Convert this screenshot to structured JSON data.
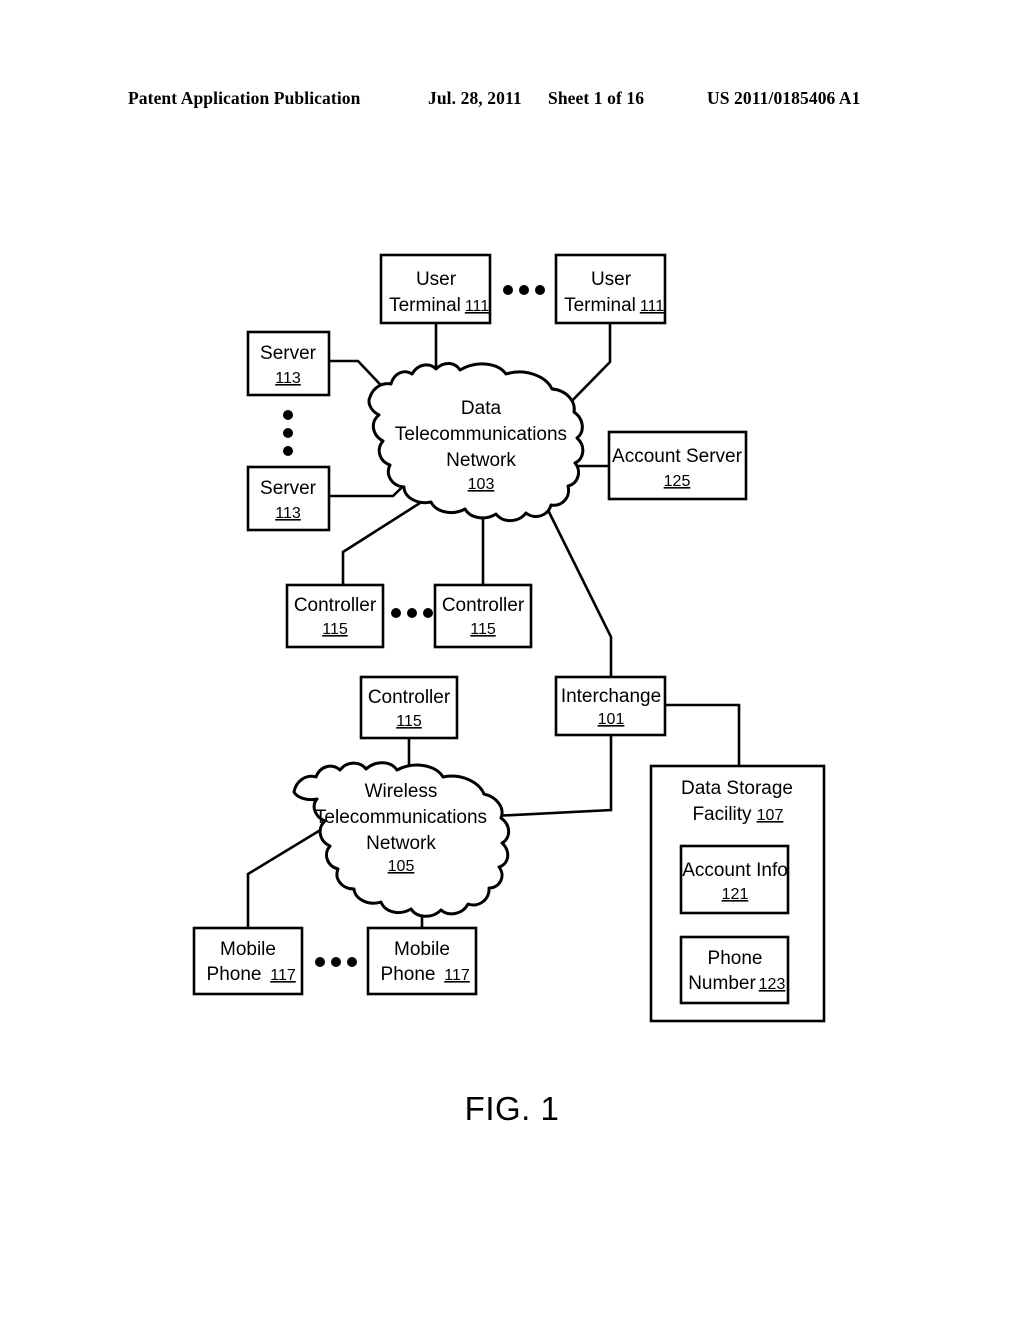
{
  "header": {
    "title": "Patent Application Publication",
    "date": "Jul. 28, 2011",
    "sheet": "Sheet 1 of 16",
    "number": "US 2011/0185406 A1"
  },
  "figure": {
    "caption": "FIG. 1"
  },
  "nodes": {
    "user_terminal_left": {
      "line1": "User",
      "line2": "Terminal",
      "ref": "111"
    },
    "user_terminal_right": {
      "line1": "User",
      "line2": "Terminal",
      "ref": "111"
    },
    "server_top": {
      "line1": "Server",
      "ref": "113"
    },
    "server_bottom": {
      "line1": "Server",
      "ref": "113"
    },
    "data_network": {
      "line1": "Data",
      "line2": "Telecommunications",
      "line3": "Network",
      "ref": "103"
    },
    "account_server": {
      "line1": "Account Server",
      "ref": "125"
    },
    "controller_left": {
      "line1": "Controller",
      "ref": "115"
    },
    "controller_right": {
      "line1": "Controller",
      "ref": "115"
    },
    "controller_lower": {
      "line1": "Controller",
      "ref": "115"
    },
    "interchange": {
      "line1": "Interchange",
      "ref": "101"
    },
    "wireless_network": {
      "line1": "Wireless",
      "line2": "Telecommunications",
      "line3": "Network",
      "ref": "105"
    },
    "data_storage": {
      "line1": "Data Storage",
      "line2": "Facility",
      "ref": "107"
    },
    "account_info": {
      "line1": "Account Info",
      "ref": "121"
    },
    "phone_number": {
      "line1": "Phone",
      "line2": "Number",
      "ref": "123"
    },
    "mobile_phone_left": {
      "line1": "Mobile",
      "line2": "Phone",
      "ref": "117"
    },
    "mobile_phone_right": {
      "line1": "Mobile",
      "line2": "Phone",
      "ref": "117"
    }
  },
  "colors": {
    "ink": "#000000",
    "paper": "#ffffff"
  }
}
